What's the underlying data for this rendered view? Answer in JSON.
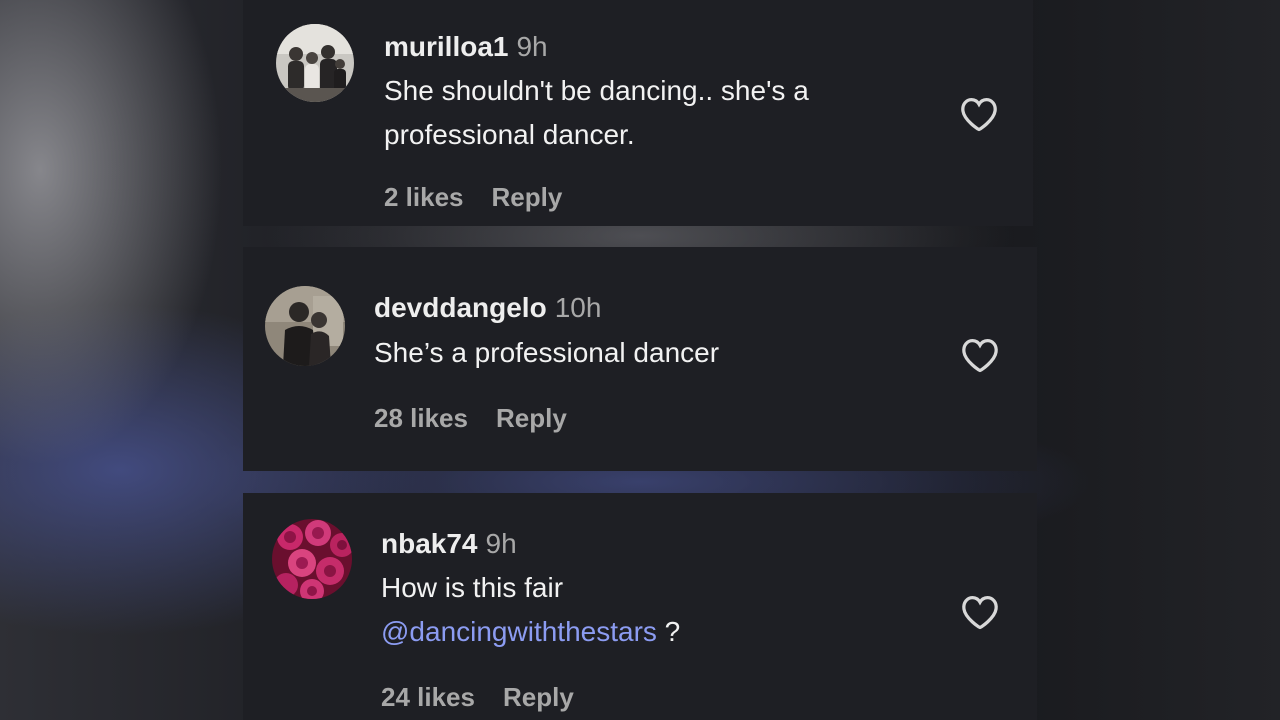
{
  "comments": [
    {
      "username": "murilloa1",
      "time": "9h",
      "text_line1": "She shouldn't be dancing.. she's a",
      "text_line2": "professional dancer.",
      "likes": "2 likes",
      "reply": "Reply"
    },
    {
      "username": "devddangelo",
      "time": "10h",
      "text_line1": "She’s a professional dancer",
      "likes": "28 likes",
      "reply": "Reply"
    },
    {
      "username": "nbak74",
      "time": "9h",
      "text_line1": "How is this fair",
      "mention": "@dancingwiththestars",
      "mention_suffix": " ?",
      "likes": "24 likes",
      "reply": "Reply"
    }
  ],
  "colors": {
    "card_bg": "#1e1f24",
    "text": "#f2f2f2",
    "muted": "#a8a8a8",
    "mention": "#8c9cf2"
  },
  "icons": {
    "like": "heart-icon"
  }
}
